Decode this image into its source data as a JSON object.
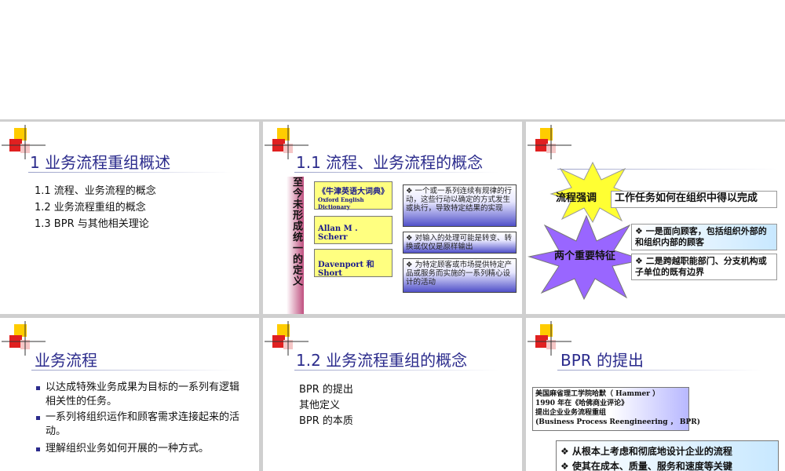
{
  "slide1": {
    "title": "1   业务流程重组概述",
    "items": [
      "1.1  流程、业务流程的概念",
      "1.2  业务流程重组的概念",
      "1.3 BPR  与其他相关理论"
    ]
  },
  "slide2": {
    "title": "1.1  流程、业务流程的概念",
    "vertical_label": "至今未形成统一的定义",
    "sources": [
      {
        "name": "《牛津英语大词典》",
        "sub": "Oxford English Dictionary"
      },
      {
        "name": "Allan M .    Scherr",
        "sub": ""
      },
      {
        "name": "Davenport  和   Short",
        "sub": ""
      }
    ],
    "definitions": [
      "❖  一个或一系列连续有规律的行动，这些行动以确定的方式发生或执行，导致特定结果的实现",
      "❖  对输入的处理可能是转变、转换或仅仅是原样输出",
      "❖  为特定顾客或市场提供特定产品或服务而实施的一系列精心设计的活动"
    ]
  },
  "slide3": {
    "star1": "流程强调",
    "emphasis": "工作任务如何在组织中得以完成",
    "star2": "两个重要特征",
    "features": [
      "❖  一是面向顾客，包括组织外部的和组织内部的顾客",
      "❖  二是跨越职能部门、分支机构或子单位的既有边界"
    ]
  },
  "slide4": {
    "title": "业务流程",
    "bullets": [
      "以达成特殊业务成果为目标的一系列有逻辑相关性的任务。",
      "一系列将组织运作和顾客需求连接起来的活动。",
      "理解组织业务如何开展的一种方式。"
    ]
  },
  "slide5": {
    "title": "1.2  业务流程重组的概念",
    "items": [
      "BPR  的提出",
      " 其他定义",
      "BPR  的本质"
    ]
  },
  "slide6": {
    "title": "BPR  的提出",
    "box_lines": [
      "美国麻省理工学院哈默（ Hammer ）",
      "1990  年在《哈佛商业评论》",
      "  提出企业业务流程重组",
      "(Business Process Reengineering ，  BPR)"
    ],
    "points": [
      "❖  从根本上考虑和彻底地设计企业的流程",
      "❖  使其在成本、质量、服务和速度等关键"
    ]
  },
  "colors": {
    "title": "#2b2b8c",
    "accent_red": "#e02020",
    "accent_yellow": "#ffcc00",
    "star_yellow": "#ffff33",
    "star_purple": "#9966ff"
  }
}
